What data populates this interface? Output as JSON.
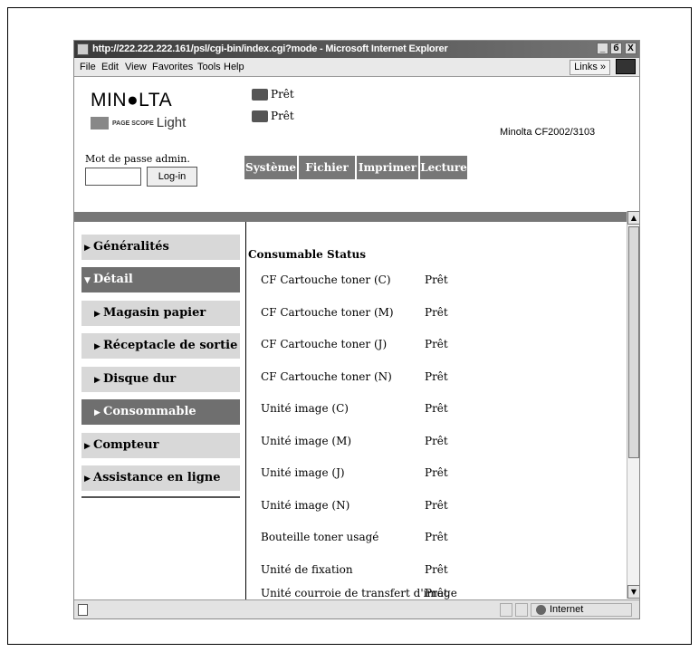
{
  "browser": {
    "title": "http://222.222.222.161/psl/cgi-bin/index.cgi?mode - Microsoft Internet Explorer",
    "controls": {
      "minimize": "_",
      "restore": "б",
      "close": "X"
    },
    "menu": [
      "File",
      "Edit",
      "View",
      "Favorites",
      "Tools",
      "Help"
    ],
    "links_label": "Links »",
    "status_zone": "Internet"
  },
  "header": {
    "logo": "MIN●LTA",
    "logo_sub": "Light",
    "logo_tag": "PAGE SCOPE",
    "status1": "Prêt",
    "status2": "Prêt",
    "model": "Minolta CF2002/3103",
    "password_label": "Mot de passe admin.",
    "login_button": "Log-in",
    "tabs": [
      "Système",
      "Fichier",
      "Imprimer",
      "Lecture"
    ]
  },
  "nav": [
    {
      "label": "Généralités",
      "arrow": "▶"
    },
    {
      "label": "Détail",
      "arrow": "▼"
    },
    {
      "label": "Magasin papier",
      "arrow": "▶"
    },
    {
      "label": "Réceptacle de sortie",
      "arrow": "▶"
    },
    {
      "label": "Disque dur",
      "arrow": "▶"
    },
    {
      "label": "Consommable",
      "arrow": "▶"
    },
    {
      "label": "Compteur",
      "arrow": "▶"
    },
    {
      "label": "Assistance en ligne",
      "arrow": "▶"
    }
  ],
  "main": {
    "section_title": "Consumable Status",
    "rows": [
      {
        "name": "CF Cartouche toner (C)",
        "status": "Prêt"
      },
      {
        "name": "CF Cartouche toner (M)",
        "status": "Prêt"
      },
      {
        "name": "CF Cartouche toner (J)",
        "status": "Prêt"
      },
      {
        "name": "CF Cartouche toner (N)",
        "status": "Prêt"
      },
      {
        "name": "Unité image (C)",
        "status": "Prêt"
      },
      {
        "name": "Unité image (M)",
        "status": "Prêt"
      },
      {
        "name": "Unité image (J)",
        "status": "Prêt"
      },
      {
        "name": "Unité image (N)",
        "status": "Prêt"
      },
      {
        "name": "Bouteille toner usagé",
        "status": "Prêt"
      },
      {
        "name": "Unité de fixation",
        "status": "Prêt"
      },
      {
        "name": "Unité courroie de transfert d'image",
        "status": "Prêt"
      }
    ]
  }
}
